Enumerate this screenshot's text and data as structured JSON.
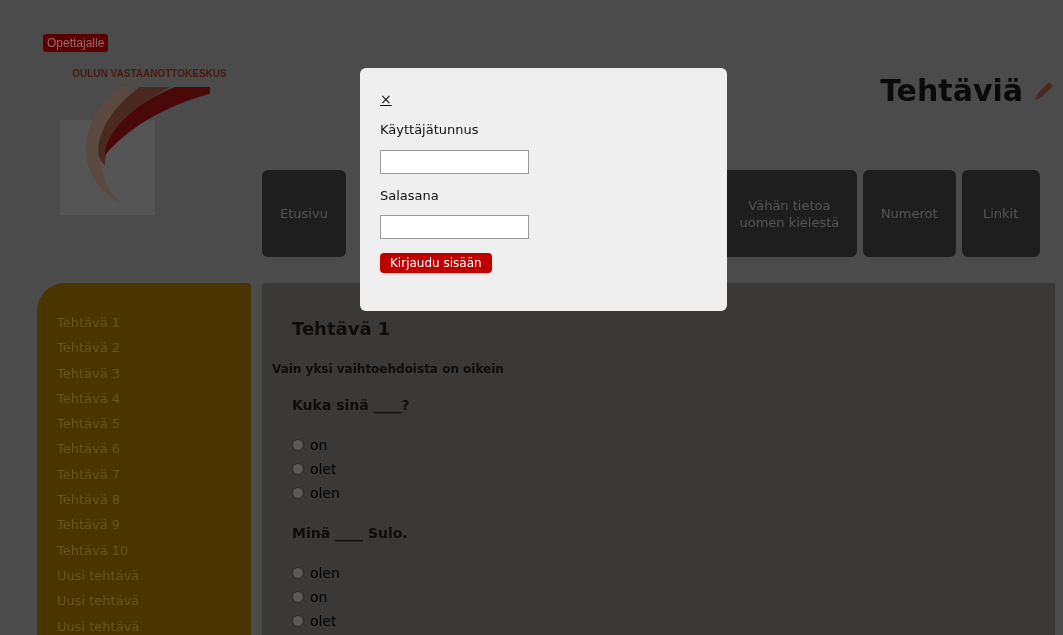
{
  "teacher_button": "Opettajalle",
  "logo": {
    "text": "OULUN VASTAANOTTOKESKUS"
  },
  "page_title": "Tehtäviä",
  "nav": [
    {
      "kind": "full",
      "lines": [
        "Etusivu"
      ]
    },
    {
      "kind": "cut",
      "lines": [
        "Vähän tietoa",
        "uomen kielestä"
      ]
    },
    {
      "kind": "full",
      "lines": [
        "Numerot"
      ]
    },
    {
      "kind": "full",
      "lines": [
        "Linkit"
      ]
    }
  ],
  "sidebar": {
    "items": [
      "Tehtävä 1",
      "Tehtävä 2",
      "Tehtävä 3",
      "Tehtävä 4",
      "Tehtävä 5",
      "Tehtävä 6",
      "Tehtävä 7",
      "Tehtävä 8",
      "Tehtävä 9",
      "Tehtävä 10",
      "Uusi tehtävä",
      "Uusi tehtävä",
      "Uusi tehtävä"
    ]
  },
  "content": {
    "title": "Tehtävä 1",
    "instruction": "Vain yksi vaihtoehdoista on oikein",
    "questions": [
      {
        "text": "Kuka sinä ____?",
        "options": [
          {
            "label": "on",
            "selected": false
          },
          {
            "label": "olet",
            "selected": false
          },
          {
            "label": "olen",
            "selected": false
          }
        ]
      },
      {
        "text": "Minä ____ Sulo.",
        "options": [
          {
            "label": "olen",
            "selected": false
          },
          {
            "label": "on",
            "selected": false
          },
          {
            "label": "olet",
            "selected": false
          }
        ]
      }
    ]
  },
  "login_dialog": {
    "close": "×",
    "username_label": "Käyttäjätunnus",
    "password_label": "Salasana",
    "submit": "Kirjaudu sisään"
  }
}
